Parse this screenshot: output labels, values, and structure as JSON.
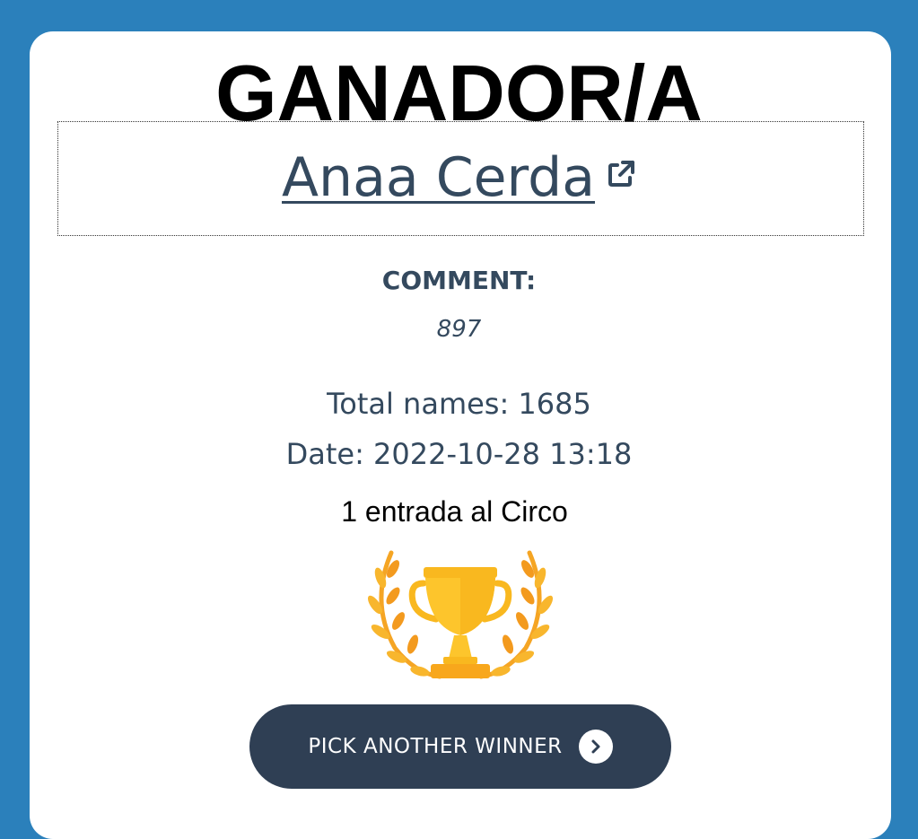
{
  "header": {
    "title": "GANADOR/A"
  },
  "winner": {
    "name": "Anaa Cerda",
    "link_icon": "external-link-icon"
  },
  "comment": {
    "label": "COMMENT:",
    "text": "897"
  },
  "stats": {
    "total_names": "Total names: 1685",
    "date": "Date: 2022-10-28 13:18"
  },
  "prize": {
    "text": "1 entrada al Circo"
  },
  "trophy": {
    "icon": "trophy-laurel-icon"
  },
  "actions": {
    "pick_another_label": "PICK ANOTHER WINNER",
    "pick_another_icon": "chevron-right-icon"
  },
  "colors": {
    "background": "#2b80bb",
    "text_dark": "#34495e",
    "button_bg": "#2f3f54",
    "trophy_gold": "#fdc52c",
    "laurel_orange": "#f5a524"
  }
}
